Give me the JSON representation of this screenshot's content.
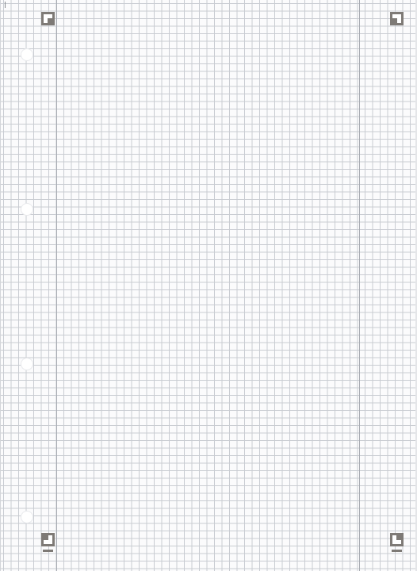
{
  "page": {
    "type": "graph-paper-sheet",
    "grid": "square",
    "margins": [
      "left",
      "right"
    ],
    "punch_holes": 4,
    "registration_markers": [
      "top-left",
      "top-right",
      "bottom-left",
      "bottom-right"
    ],
    "colors": {
      "paper": "#fbfbfc",
      "grid_line": "#c9ccd2",
      "margin_line": "#a7abb2",
      "marker": "#7e7a76"
    }
  }
}
